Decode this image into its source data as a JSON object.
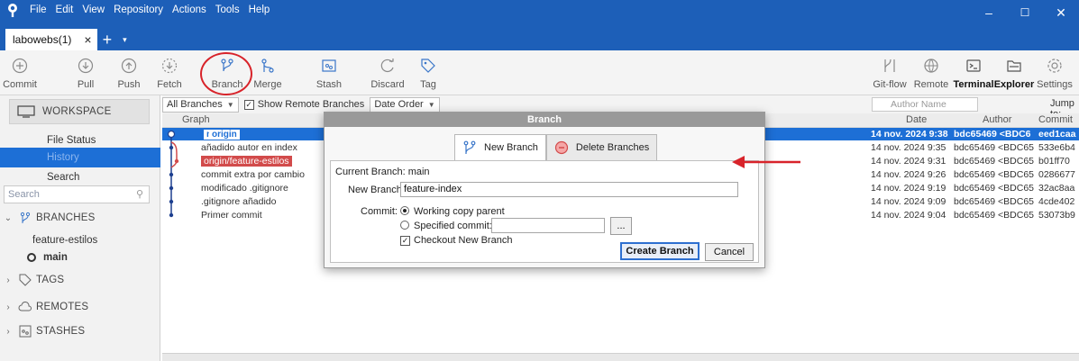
{
  "window": {
    "menu": [
      "File",
      "Edit",
      "View",
      "Repository",
      "Actions",
      "Tools",
      "Help"
    ],
    "tab_label": "labowebs(1)",
    "tab_close": "×",
    "tab_plus": "+",
    "tab_dropdown": "▾",
    "controls": {
      "minimize": "–",
      "maximize": "☐",
      "close": "✕"
    }
  },
  "toolbar": {
    "commit": "Commit",
    "pull": "Pull",
    "push": "Push",
    "fetch": "Fetch",
    "branch": "Branch",
    "merge": "Merge",
    "stash": "Stash",
    "discard": "Discard",
    "tag": "Tag",
    "gitflow": "Git-flow",
    "remote": "Remote",
    "terminal": "Terminal",
    "explorer": "Explorer",
    "settings": "Settings"
  },
  "sidebar": {
    "workspace": "WORKSPACE",
    "file_status": "File Status",
    "history": "History",
    "search": "Search",
    "search_placeholder": "Search",
    "branches_header": "BRANCHES",
    "branches": [
      "feature-estilos",
      "main"
    ],
    "tags_header": "TAGS",
    "remotes_header": "REMOTES",
    "stashes_header": "STASHES"
  },
  "filter_bar": {
    "branches_combo": "All Branches",
    "show_remote": "Show Remote Branches",
    "order_combo": "Date Order",
    "author_placeholder": "Author Name",
    "jump_to": "Jump to:"
  },
  "columns": {
    "graph": "Graph",
    "date": "Date",
    "author": "Author",
    "commit": "Commit"
  },
  "commits": [
    {
      "tag1": "main",
      "tag2": "origin",
      "date": "14 nov. 2024 9:38",
      "author": "bdc65469 <BDC6",
      "hash": "eed1caa"
    },
    {
      "desc": "añadido autor en index",
      "date": "14 nov. 2024 9:35",
      "author": "bdc65469 <BDC65",
      "hash": "533e6b4"
    },
    {
      "tag": "origin/feature-estilos",
      "date": "14 nov. 2024 9:31",
      "author": "bdc65469 <BDC65",
      "hash": "b01ff70"
    },
    {
      "desc": "commit extra por cambio",
      "date": "14 nov. 2024 9:26",
      "author": "bdc65469 <BDC65",
      "hash": "0286677"
    },
    {
      "desc": "modificado .gitignore",
      "date": "14 nov. 2024 9:19",
      "author": "bdc65469 <BDC65",
      "hash": "32ac8aa"
    },
    {
      "desc": ".gitignore añadido",
      "date": "14 nov. 2024 9:09",
      "author": "bdc65469 <BDC65",
      "hash": "4cde402"
    },
    {
      "desc": "Primer commit",
      "date": "14 nov. 2024 9:04",
      "author": "bdc65469 <BDC65",
      "hash": "53073b9"
    }
  ],
  "dialog": {
    "title": "Branch",
    "tab_new": "New Branch",
    "tab_delete": "Delete Branches",
    "current_branch_label": "Current Branch: main",
    "new_branch_label": "New Branch:",
    "new_branch_value": "feature-index",
    "commit_label": "Commit:",
    "opt_working": "Working copy parent",
    "opt_specified": "Specified commit:",
    "browse": "...",
    "checkout": "Checkout New Branch",
    "create": "Create Branch",
    "cancel": "Cancel"
  },
  "colors": {
    "titlebar": "#1d5fb8",
    "selection": "#1d6fd6",
    "annotation": "#d8232a"
  }
}
